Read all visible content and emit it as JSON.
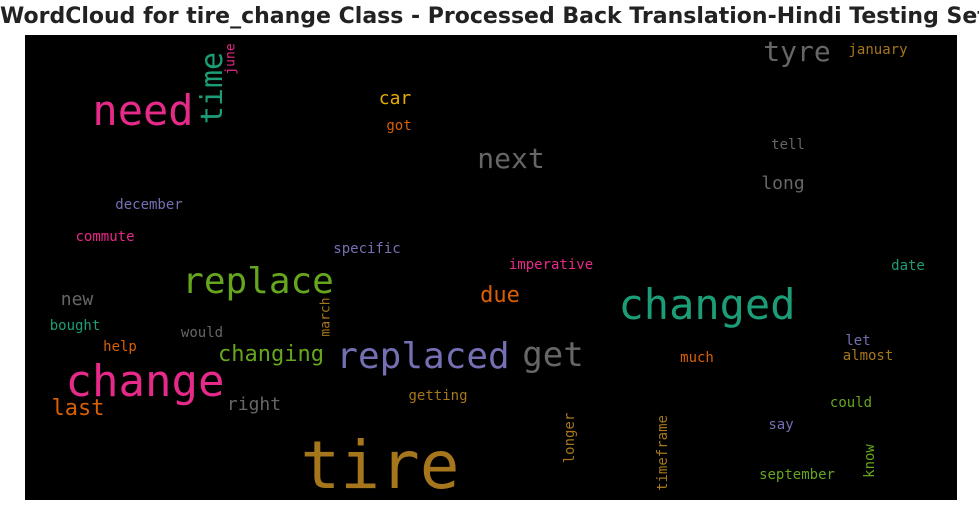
{
  "chart_data": {
    "type": "wordcloud",
    "title": "WordCloud for tire_change Class - Processed Back Translation-Hindi Testing Set",
    "background": "#000000",
    "words": [
      {
        "text": "tire",
        "color": "#a6761d"
      },
      {
        "text": "changed",
        "color": "#1b9e77"
      },
      {
        "text": "change",
        "color": "#e7298a"
      },
      {
        "text": "need",
        "color": "#e7298a"
      },
      {
        "text": "replace",
        "color": "#66a61e"
      },
      {
        "text": "replaced",
        "color": "#7570b3"
      },
      {
        "text": "get",
        "color": "#666666"
      },
      {
        "text": "time",
        "color": "#1b9e77",
        "orientation": "vertical"
      },
      {
        "text": "next",
        "color": "#666666"
      },
      {
        "text": "tyre",
        "color": "#666666"
      },
      {
        "text": "changing",
        "color": "#66a61e"
      },
      {
        "text": "due",
        "color": "#d95f02"
      },
      {
        "text": "last",
        "color": "#d95f02"
      },
      {
        "text": "right",
        "color": "#666666"
      },
      {
        "text": "long",
        "color": "#666666"
      },
      {
        "text": "car",
        "color": "#e6ab02"
      },
      {
        "text": "new",
        "color": "#666666"
      },
      {
        "text": "december",
        "color": "#7570b3"
      },
      {
        "text": "commute",
        "color": "#e7298a"
      },
      {
        "text": "specific",
        "color": "#7570b3"
      },
      {
        "text": "imperative",
        "color": "#e7298a"
      },
      {
        "text": "date",
        "color": "#1b9e77"
      },
      {
        "text": "got",
        "color": "#d95f02"
      },
      {
        "text": "tell",
        "color": "#666666"
      },
      {
        "text": "january",
        "color": "#a6761d"
      },
      {
        "text": "june",
        "color": "#e7298a",
        "orientation": "vertical"
      },
      {
        "text": "bought",
        "color": "#1b9e77"
      },
      {
        "text": "would",
        "color": "#666666"
      },
      {
        "text": "help",
        "color": "#d95f02"
      },
      {
        "text": "march",
        "color": "#a6761d",
        "orientation": "vertical"
      },
      {
        "text": "let",
        "color": "#7570b3"
      },
      {
        "text": "almost",
        "color": "#a6761d"
      },
      {
        "text": "much",
        "color": "#d95f02"
      },
      {
        "text": "getting",
        "color": "#a6761d"
      },
      {
        "text": "could",
        "color": "#66a61e"
      },
      {
        "text": "say",
        "color": "#7570b3"
      },
      {
        "text": "longer",
        "color": "#a6761d",
        "orientation": "vertical"
      },
      {
        "text": "timeframe",
        "color": "#a6761d",
        "orientation": "vertical"
      },
      {
        "text": "know",
        "color": "#66a61e",
        "orientation": "vertical"
      },
      {
        "text": "september",
        "color": "#66a61e"
      }
    ]
  }
}
